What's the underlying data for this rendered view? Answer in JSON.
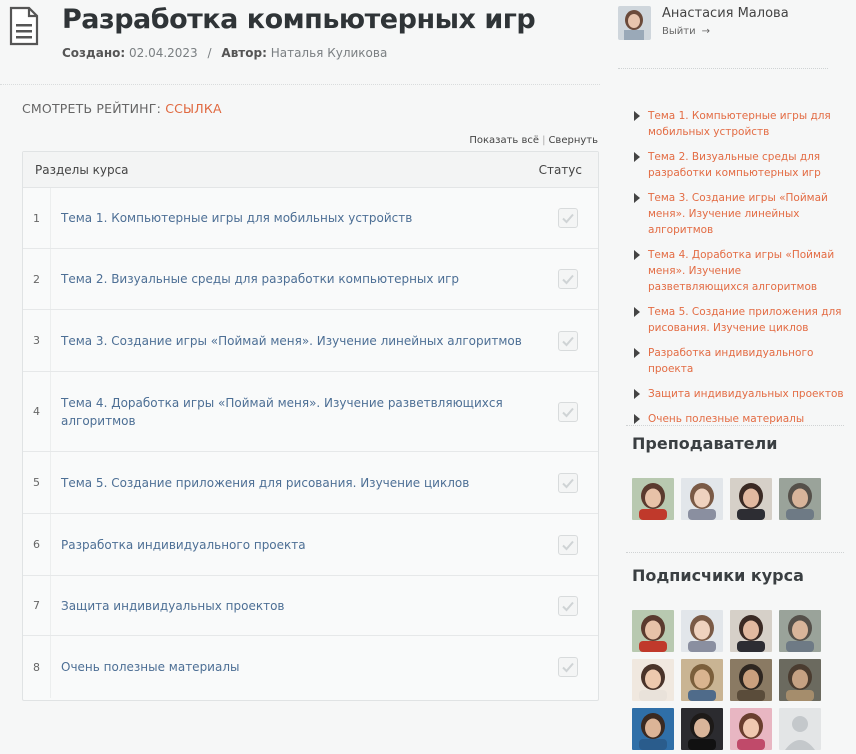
{
  "page": {
    "title": "Разработка компьютерных игр",
    "created_label": "Создано:",
    "created_date": "02.04.2023",
    "separator": "/",
    "author_label": "Автор:",
    "author_name": "Наталья Куликова",
    "rating_label": "СМОТРЕТЬ РЕЙТИНГ:",
    "rating_link": "ССЫЛКА",
    "show_all": "Показать всё",
    "collapse": "Свернуть"
  },
  "table": {
    "col_sections": "Разделы курса",
    "col_status": "Статус",
    "rows": [
      {
        "num": "1",
        "title": "Тема 1. Компьютерные игры для мобильных устройств"
      },
      {
        "num": "2",
        "title": "Тема 2. Визуальные среды для разработки компьютерных игр"
      },
      {
        "num": "3",
        "title": "Тема 3. Создание игры «Поймай меня». Изучение линейных алгоритмов"
      },
      {
        "num": "4",
        "title": "Тема 4. Доработка игры «Поймай меня». Изучение разветвляющихся алгоритмов"
      },
      {
        "num": "5",
        "title": "Тема 5. Создание приложения для рисования. Изучение циклов"
      },
      {
        "num": "6",
        "title": "Разработка индивидуального проекта"
      },
      {
        "num": "7",
        "title": "Защита индивидуальных проектов"
      },
      {
        "num": "8",
        "title": "Очень полезные материалы"
      }
    ]
  },
  "user": {
    "name": "Анастасия Малова",
    "logout": "Выйти",
    "logout_arrow": "→"
  },
  "toc": [
    "Тема 1. Компьютерные игры для мобильных устройств",
    "Тема 2. Визуальные среды для разработки компьютерных игр",
    "Тема 3. Создание игры «Поймай меня». Изучение линейных алгоритмов",
    "Тема 4. Доработка игры «Поймай меня». Изучение разветвляющихся алгоритмов",
    "Тема 5. Создание приложения для рисования. Изучение циклов",
    "Разработка индивидуального проекта",
    "Защита индивидуальных проектов",
    "Очень полезные материалы"
  ],
  "teachers_title": "Преподаватели",
  "subscribers_title": "Подписчики курса",
  "colors": {
    "link_blue": "#4d6f95",
    "accent_orange": "#e0683f"
  }
}
